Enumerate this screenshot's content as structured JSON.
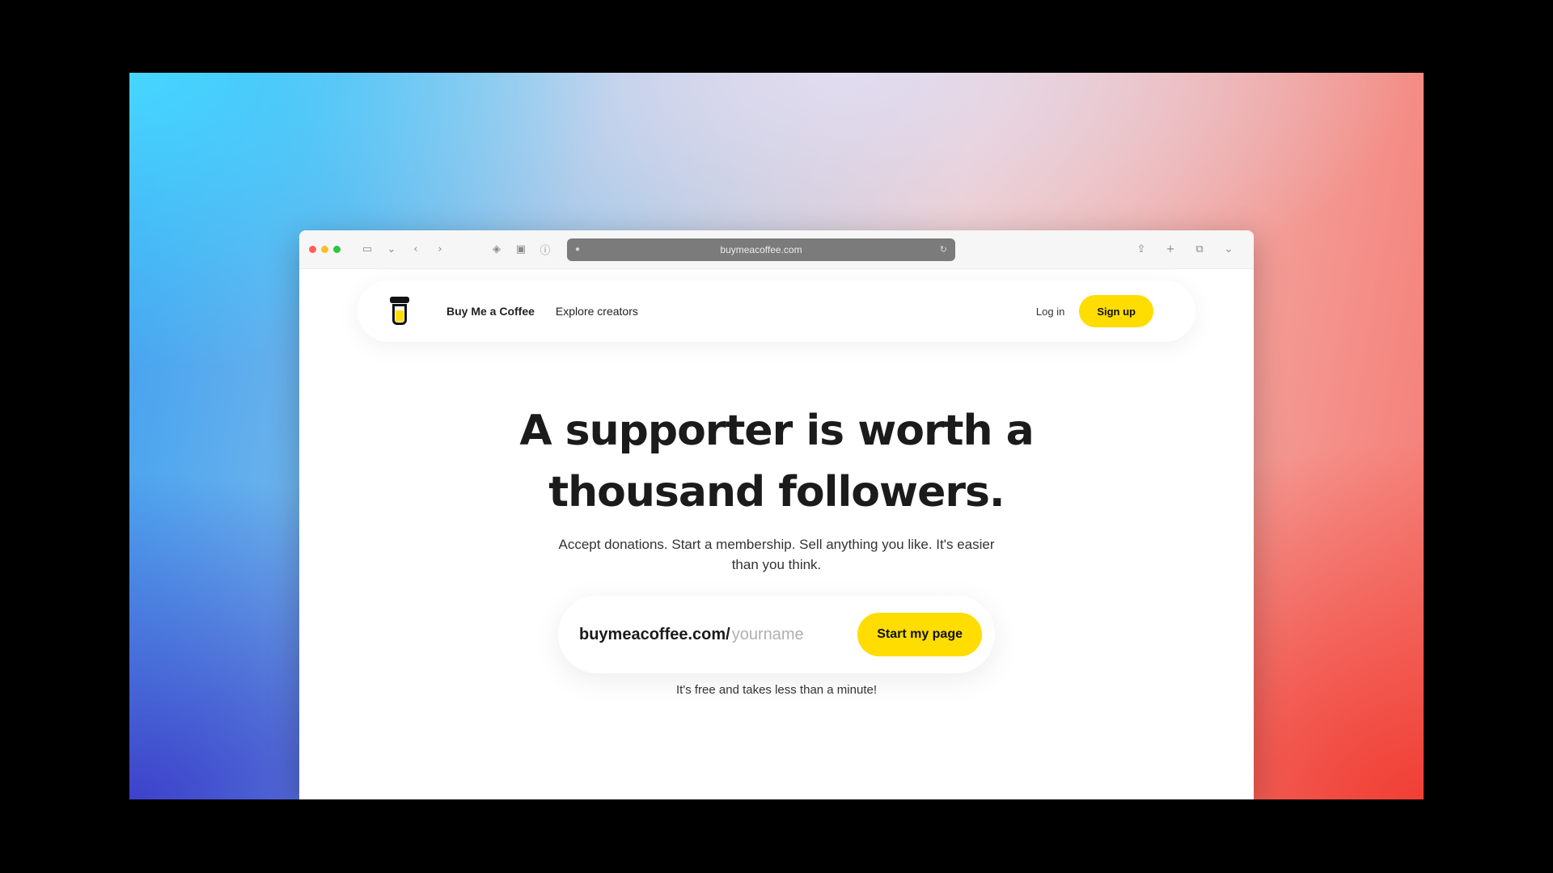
{
  "browser": {
    "traffic_colors": [
      "#ff5f57",
      "#febc2e",
      "#28c840"
    ],
    "address": "buymeacoffee.com",
    "toolbar_icons": [
      "sidebar-icon",
      "back-icon",
      "forward-icon",
      "shield-icon",
      "extension-icon",
      "share-icon",
      "new-tab-icon",
      "tabs-icon"
    ]
  },
  "nav": {
    "links": [
      "Buy Me a Coffee",
      "Explore creators"
    ],
    "login": "Log in",
    "signup": "Sign up"
  },
  "hero": {
    "headline": "A supporter is worth a thousand followers.",
    "subtext": "Accept donations. Start a membership. Sell anything you like. It's easier than you think."
  },
  "claim": {
    "prefix": "buymeacoffee.com/",
    "placeholder": "yourname",
    "cta": "Start my page",
    "fine_print": "It's free and takes less than a minute!"
  },
  "colors": {
    "accent": "#ffdd00",
    "text": "#1b1b1b"
  }
}
